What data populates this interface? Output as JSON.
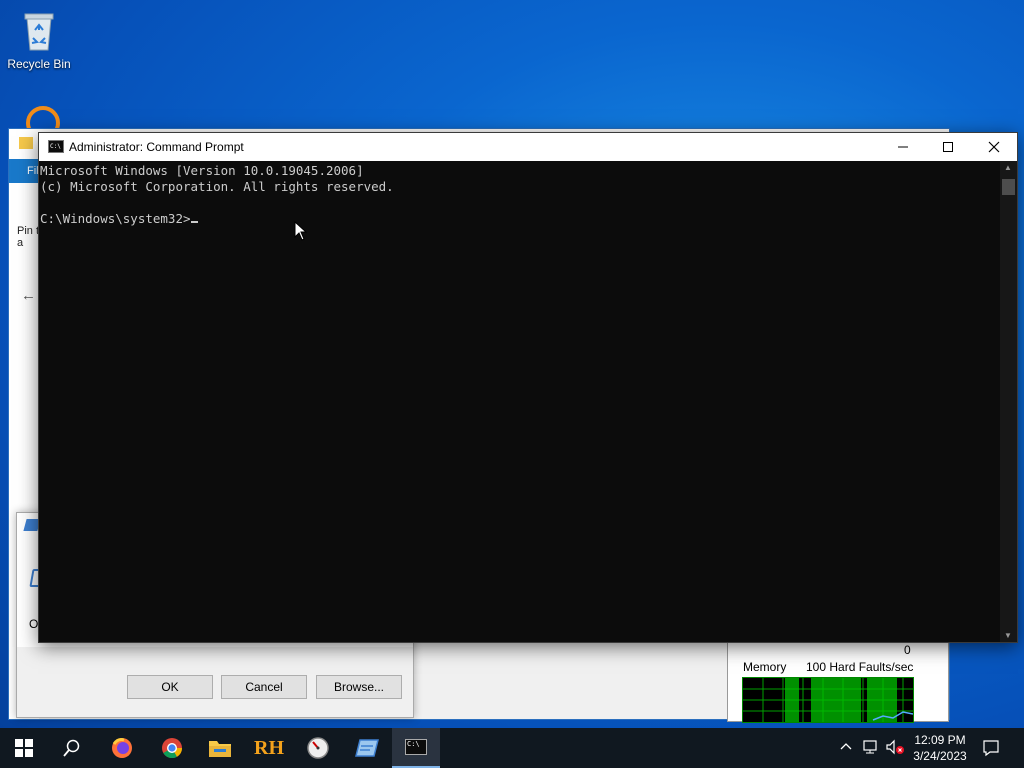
{
  "desktop": {
    "recycle_bin_label": "Recycle Bin"
  },
  "explorer": {
    "ribbon_tab": "Fil",
    "pin_text": "Pin t\na"
  },
  "run_dialog": {
    "ok_label": "OK",
    "cancel_label": "Cancel",
    "browse_label": "Browse...",
    "field_letter": "O"
  },
  "taskmgr": {
    "zero_label": "0",
    "memory_label": "Memory",
    "faults_label": "100 Hard Faults/sec"
  },
  "cmd": {
    "title": "Administrator: Command Prompt",
    "line1": "Microsoft Windows [Version 10.0.19045.2006]",
    "line2": "(c) Microsoft Corporation. All rights reserved.",
    "prompt": "C:\\Windows\\system32>",
    "icon_text": "C:\\"
  },
  "taskbar": {
    "rh_label": "RH",
    "time": "12:09 PM",
    "date": "3/24/2023"
  },
  "colors": {
    "accent": "#1979ca",
    "console_bg": "#0c0c0c",
    "console_text": "#cccccc"
  }
}
